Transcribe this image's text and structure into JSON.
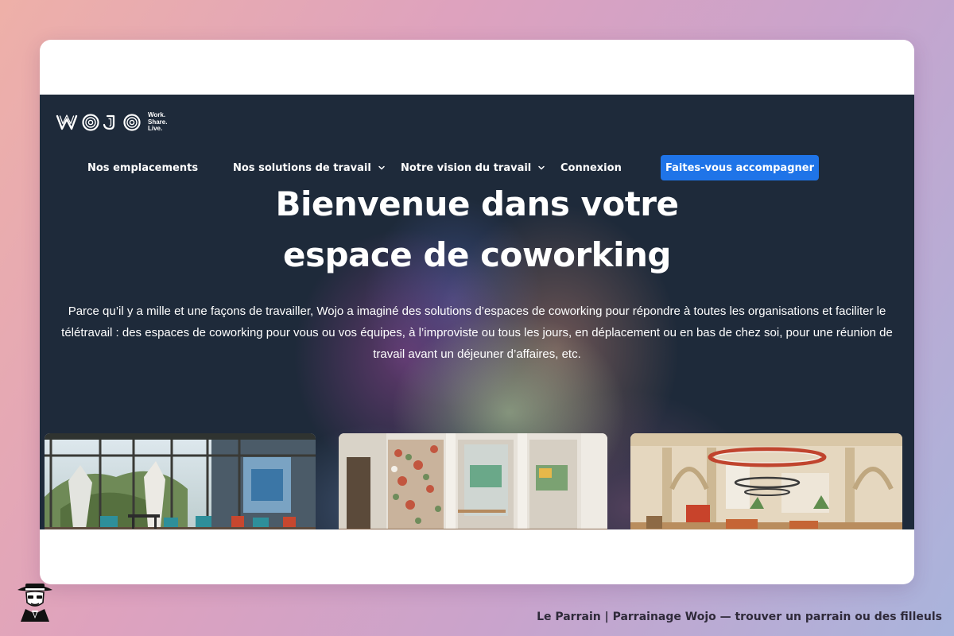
{
  "brand": {
    "name": "WOJO",
    "tagline": [
      "Work.",
      "Share.",
      "Live."
    ]
  },
  "nav": {
    "items": [
      {
        "label": "Nos emplacements",
        "has_dropdown": false
      },
      {
        "label": "Nos solutions de travail",
        "has_dropdown": true
      },
      {
        "label": "Notre vision du travail",
        "has_dropdown": true
      },
      {
        "label": "Connexion",
        "has_dropdown": false
      }
    ],
    "cta_label": "Faites-vous accompagner"
  },
  "hero": {
    "title_line1": "Bienvenue dans votre",
    "title_line2": "espace de coworking",
    "description": "Parce qu’il y a mille et une façons de travailler, Wojo a imaginé des solutions d’espaces de coworking pour répondre à toutes les organisations et faciliter le télétravail : des espaces de coworking pour vous ou vos équipes, à l’improviste ou tous les jours, en déplacement ou en bas de chez soi, pour une réunion de travail avant un déjeuner d’affaires, etc."
  },
  "photos": [
    {
      "subject": "glass-walled coworking terrace with chairs and tables"
    },
    {
      "subject": "phone booths with floral wallpaper"
    },
    {
      "subject": "arched hall with ring pendant light and lounge seating"
    }
  ],
  "footer": {
    "credit": "Le Parrain | Parrainage Wojo — trouver un parrain ou des filleuls"
  },
  "colors": {
    "hero_background": "#1e2a3a",
    "cta": "#1f74e8",
    "text_light": "#ffffff",
    "credit_text": "#2f2a3a"
  },
  "icons": {
    "dropdown": "chevron-down-icon",
    "mascot": "godfather-mascot-icon"
  }
}
